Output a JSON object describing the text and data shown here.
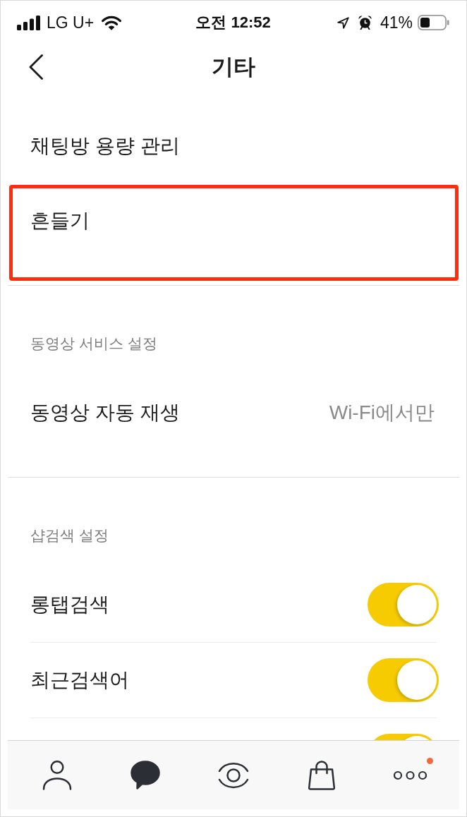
{
  "status_bar": {
    "carrier": "LG U+",
    "time": "오전 12:52",
    "battery": "41%"
  },
  "header": {
    "title": "기타"
  },
  "sections": [
    {
      "items": [
        {
          "kind": "link",
          "label": "채팅방 용량 관리",
          "highlighted": false
        },
        {
          "kind": "link",
          "label": "흔들기",
          "highlighted": true
        }
      ]
    },
    {
      "title": "동영상 서비스 설정",
      "items": [
        {
          "kind": "value",
          "label": "동영상 자동 재생",
          "value": "Wi-Fi에서만"
        }
      ]
    },
    {
      "title": "샵검색 설정",
      "items": [
        {
          "kind": "toggle",
          "label": "롱탭검색",
          "on": true
        },
        {
          "kind": "toggle",
          "label": "최근검색어",
          "on": true
        },
        {
          "kind": "toggle",
          "on": true
        }
      ]
    }
  ],
  "tab_bar": [
    {
      "selected": false,
      "badge": false
    },
    {
      "selected": true,
      "badge": false
    },
    {
      "selected": false,
      "badge": false
    },
    {
      "selected": false,
      "badge": false
    },
    {
      "selected": false,
      "badge": true
    }
  ]
}
